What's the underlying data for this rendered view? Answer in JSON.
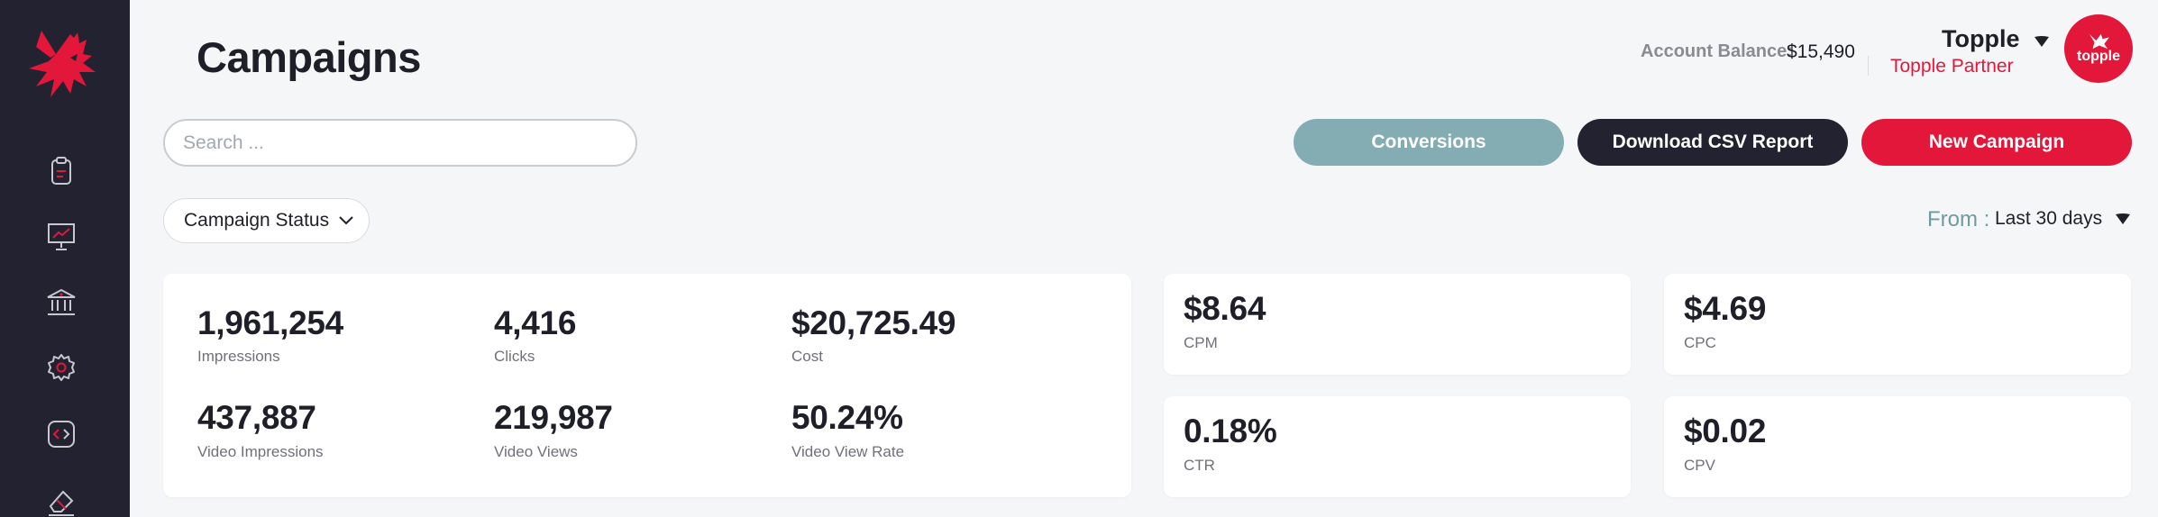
{
  "header": {
    "title": "Campaigns",
    "account_balance_label": "Account Balance:",
    "account_balance_value": "$15,490",
    "user_name": "Topple",
    "user_role": "Topple Partner",
    "avatar_text": "topple"
  },
  "sidebar": {
    "items": [
      {
        "icon": "clipboard-icon"
      },
      {
        "icon": "presentation-chart-icon"
      },
      {
        "icon": "bank-icon"
      },
      {
        "icon": "settings-gear-icon"
      },
      {
        "icon": "code-icon"
      },
      {
        "icon": "eraser-icon"
      }
    ]
  },
  "search": {
    "placeholder": "Search ..."
  },
  "toolbar": {
    "conversions_label": "Conversions",
    "download_csv_label": "Download CSV Report",
    "new_campaign_label": "New Campaign"
  },
  "filters": {
    "campaign_status_label": "Campaign Status",
    "from_label": "From :",
    "from_value": "Last 30 days"
  },
  "summary": {
    "stats": [
      {
        "value": "1,961,254",
        "label": "Impressions"
      },
      {
        "value": "4,416",
        "label": "Clicks"
      },
      {
        "value": "$20,725.49",
        "label": "Cost"
      },
      {
        "value": "437,887",
        "label": "Video Impressions"
      },
      {
        "value": "219,987",
        "label": "Video Views"
      },
      {
        "value": "50.24%",
        "label": "Video View Rate"
      }
    ]
  },
  "metrics": [
    {
      "value": "$8.64",
      "label": "CPM"
    },
    {
      "value": "$4.69",
      "label": "CPC"
    },
    {
      "value": "0.18%",
      "label": "CTR"
    },
    {
      "value": "$0.02",
      "label": "CPV"
    }
  ],
  "colors": {
    "sidebar_bg": "#222230",
    "accent_red": "#e3173a",
    "conversions_teal": "#84adb3",
    "page_bg": "#f5f6f8"
  }
}
